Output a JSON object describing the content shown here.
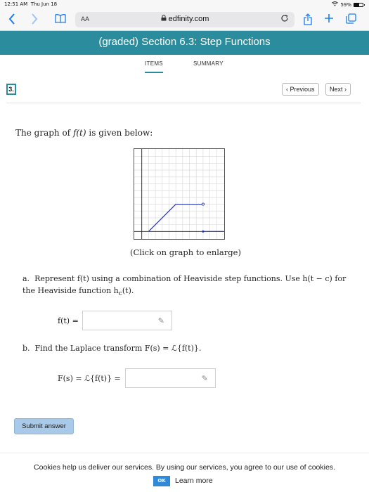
{
  "status": {
    "time": "12:51 AM",
    "date": "Thu Jun 18",
    "battery": "59%",
    "battery_level": 0.59
  },
  "browser": {
    "text_size": "AA",
    "url": "edfinity.com"
  },
  "page": {
    "title": "(graded) Section 6.3: Step Functions"
  },
  "tabs": [
    {
      "label": "ITEMS",
      "active": true
    },
    {
      "label": "SUMMARY",
      "active": false
    }
  ],
  "question": {
    "number": "3.",
    "prev_label": "Previous",
    "next_label": "Next",
    "intro_prefix": "The graph of ",
    "intro_func": "f(t)",
    "intro_suffix": " is given below:",
    "caption": "(Click on graph to enlarge)",
    "part_a_letter": "a.",
    "part_a_text": "Represent f(t) using a combination of Heaviside step functions. Use h(t − c) for the Heaviside function h",
    "part_a_sub": "c",
    "part_a_tail": "(t).",
    "f_label": "f(t) =",
    "f_value": "",
    "part_b_letter": "b.",
    "part_b_text": "Find the Laplace transform F(s) = ℒ{f(t)}.",
    "F_label": "F(s) = ℒ{f(t)} =",
    "F_value": "",
    "submit_label": "Submit answer"
  },
  "graph": {
    "xlim": [
      -1,
      12
    ],
    "ylim": [
      -1,
      12
    ],
    "segments": [
      {
        "x": [
          1,
          5
        ],
        "y": [
          0,
          4
        ]
      },
      {
        "x": [
          5,
          9
        ],
        "y": [
          4,
          4
        ]
      },
      {
        "x": [
          9,
          12
        ],
        "y": [
          0,
          0
        ]
      }
    ],
    "open_points": [
      {
        "x": 9,
        "y": 4
      }
    ],
    "closed_points": [
      {
        "x": 9,
        "y": 0
      }
    ]
  },
  "cookie": {
    "message": "Cookies help us deliver our services. By using our services, you agree to our use of cookies.",
    "ok_label": "OK",
    "learn_label": "Learn more"
  },
  "colors": {
    "accent": "#2a8c9c",
    "link": "#1a7df4",
    "submit": "#a8c9e8",
    "plot_line": "#2b35b8"
  },
  "icons": [
    "back-icon",
    "forward-icon",
    "bookmarks-icon",
    "lock-icon",
    "reload-icon",
    "share-icon",
    "new-tab-icon",
    "tabs-icon",
    "pencil-icon",
    "wifi-icon",
    "battery-icon"
  ]
}
